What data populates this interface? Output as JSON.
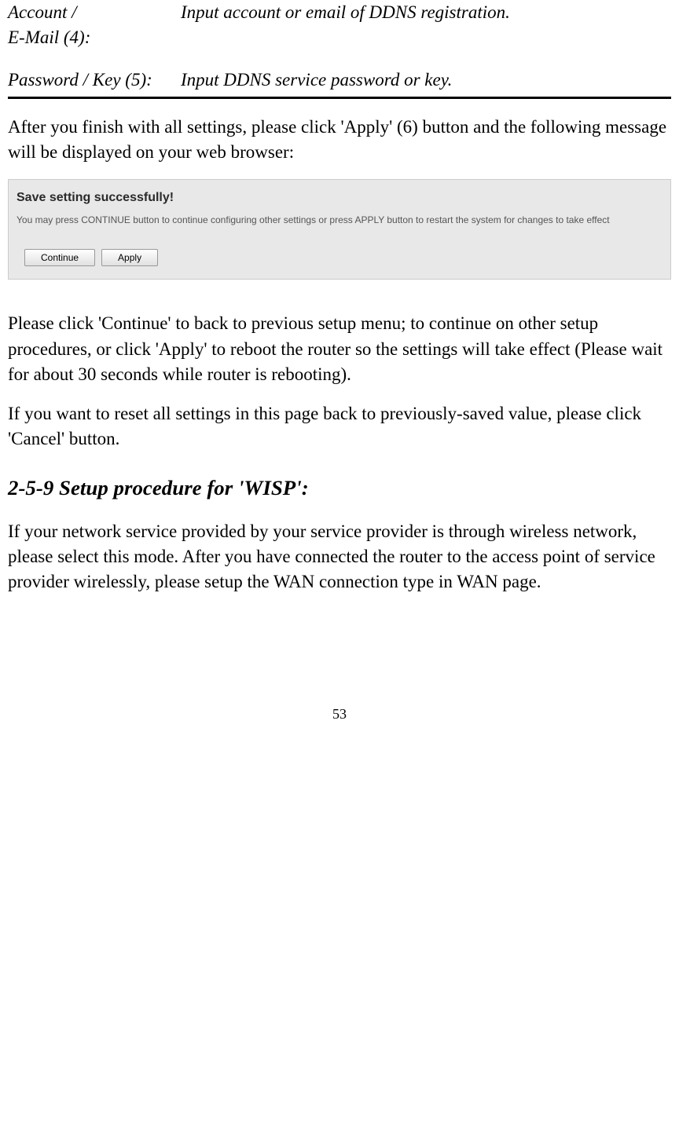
{
  "table": {
    "row1": {
      "label_line1": "Account /",
      "label_line2": "E-Mail (4):",
      "desc": "Input account or email of DDNS registration."
    },
    "row2": {
      "label": "Password / Key (5):",
      "desc": "Input DDNS service password or key."
    }
  },
  "para1": "After you finish with all settings, please click 'Apply' (6) button and the following message will be displayed on your web browser:",
  "screenshot": {
    "title": "Save setting successfully!",
    "desc": "You may press CONTINUE button to continue configuring other settings or press APPLY button to restart the system for changes to take effect",
    "continue_label": "Continue",
    "apply_label": "Apply"
  },
  "para2": "Please click 'Continue' to back to previous setup menu; to continue on other setup procedures, or click 'Apply' to reboot the router so the settings will take effect (Please wait for about 30 seconds while router is rebooting).",
  "para3": "If you want to reset all settings in this page back to previously-saved value, please click 'Cancel' button.",
  "heading": "2-5-9 Setup procedure for 'WISP':",
  "para4": "If your network service provided by your service provider is through wireless network, please select this mode. After you have connected the router to the access point of service provider wirelessly, please setup the WAN connection type in WAN page.",
  "page_number": "53"
}
